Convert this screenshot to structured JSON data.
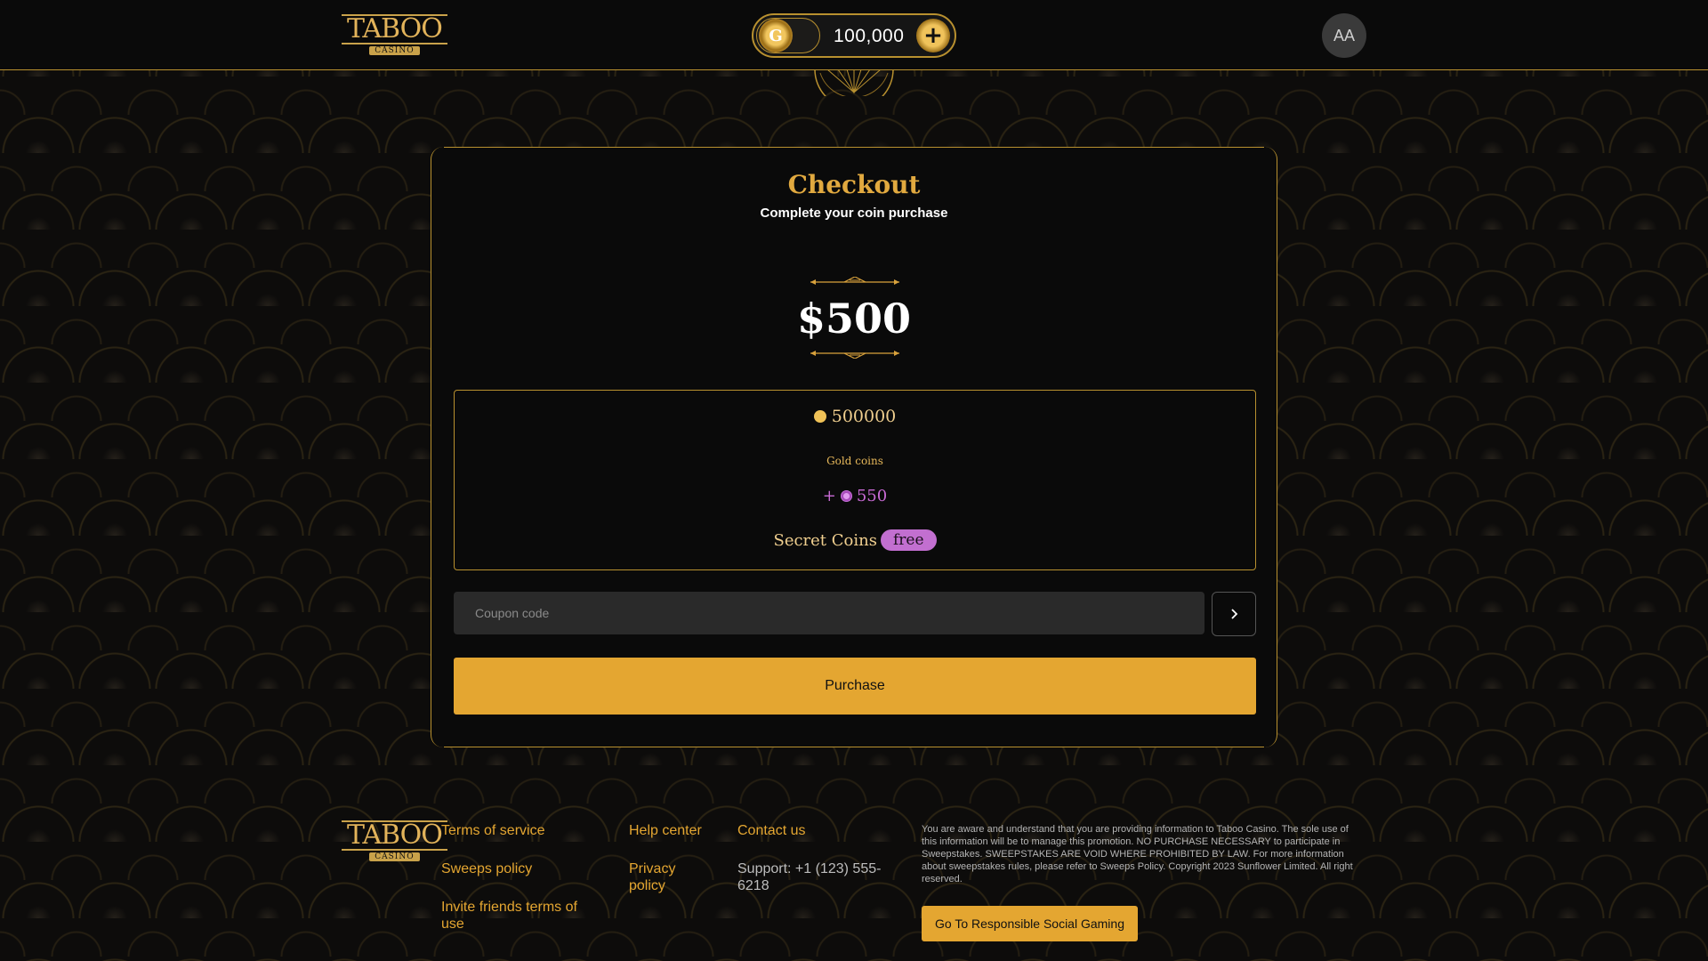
{
  "header": {
    "logo_text": "TABOO",
    "logo_sub": "CASINO",
    "balance": "100,000",
    "coin_symbol": "G",
    "add_symbol": "+",
    "avatar_initials": "AA"
  },
  "checkout": {
    "title": "Checkout",
    "subtitle": "Complete your coin purchase",
    "price": "$500",
    "gold_amount": "500000",
    "gold_label": "Gold coins",
    "secret_prefix": "+",
    "secret_amount": "550",
    "secret_label": "Secret Coins",
    "free_badge": "free",
    "coupon_placeholder": "Coupon code",
    "purchase_label": "Purchase"
  },
  "footer": {
    "logo_text": "TABOO",
    "logo_sub": "CASINO",
    "links_col1": [
      "Terms of service",
      "Sweeps policy",
      "Invite friends terms of use"
    ],
    "links_col2": [
      "Help center",
      "Privacy policy"
    ],
    "contact_title": "Contact us",
    "support": "Support: +1 (123) 555-6218",
    "disclaimer": "You are aware and understand that you are providing information to Taboo Casino. The sole use of this information will be to manage this promotion. NO PURCHASE NECESSARY to participate in Sweepstakes. SWEEPSTAKES ARE VOID WHERE PROHIBITED BY LAW. For more information about sweepstakes rules, please refer to Sweeps Policy. Copyright 2023 Sunflower Limited. All right reserved.",
    "rsg_button": "Go To Responsible Social Gaming"
  },
  "colors": {
    "accent": "#e4a631",
    "gold_text": "#e1a93f",
    "secret_purple": "#c86ad4",
    "background": "#0d0c0b"
  },
  "icons": {
    "coin": "gold-coin-icon",
    "add": "plus-coin-icon",
    "submit": "chevron-right-icon"
  }
}
